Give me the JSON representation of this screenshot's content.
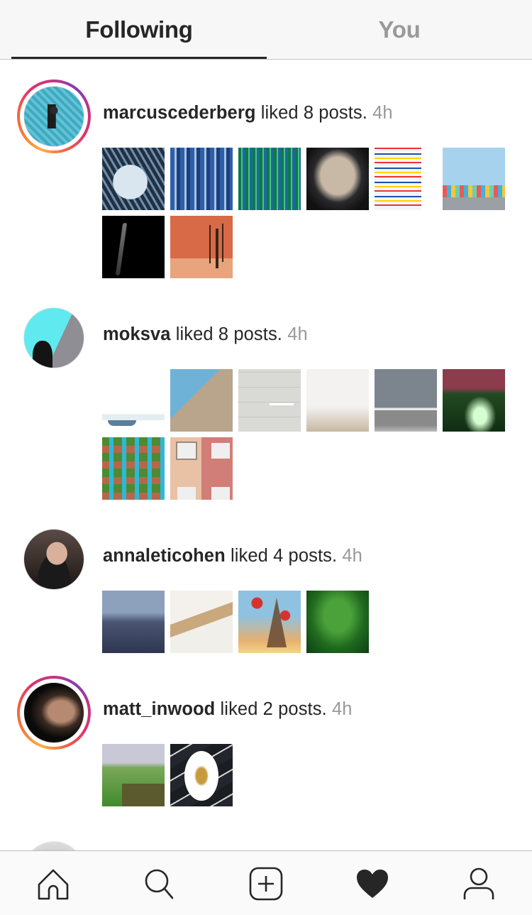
{
  "tabs": [
    {
      "label": "Following",
      "active": true
    },
    {
      "label": "You",
      "active": false
    }
  ],
  "feed": [
    {
      "username": "marcuscederberg",
      "action": " liked 8 posts. ",
      "time": "4h",
      "has_story_ring": true,
      "posts": [
        "curved-building-looking-up",
        "blue-glass-facade",
        "green-glass-building",
        "gallery-light-wall",
        "colorful-windows-facade",
        "beach-huts"
      ],
      "posts_row2": [
        "silhouette-figure",
        "dead-tree-desert"
      ]
    },
    {
      "username": "moksva",
      "action": " liked 8 posts. ",
      "time": "4h",
      "has_story_ring": false,
      "posts": [
        "boat-on-white",
        "couple-on-rocks",
        "figure-on-concrete-ledge",
        "foggy-figure",
        "birds-over-sea",
        "night-forest"
      ],
      "posts_row2": [
        "ivy-covered-building",
        "pink-facade-windows"
      ]
    },
    {
      "username": "annaleticohen",
      "action": " liked 4 posts. ",
      "time": "4h",
      "has_story_ring": false,
      "posts": [
        "handstand-dusk",
        "tea-products",
        "eiffel-tower-roses",
        "green-waterfall"
      ],
      "posts_row2": []
    },
    {
      "username": "matt_inwood",
      "action": " liked 2 posts. ",
      "time": "4h",
      "has_story_ring": true,
      "posts": [
        "cricket-field",
        "plated-dish-marble"
      ],
      "posts_row2": []
    }
  ],
  "bottom_nav": [
    {
      "name": "home",
      "icon": "home-icon"
    },
    {
      "name": "search",
      "icon": "search-icon"
    },
    {
      "name": "new-post",
      "icon": "plus-square-icon"
    },
    {
      "name": "activity",
      "icon": "heart-icon",
      "active": true
    },
    {
      "name": "profile",
      "icon": "user-icon"
    }
  ],
  "colors": {
    "text": "#262626",
    "muted": "#999999",
    "inactive_tab": "#9a9a9a",
    "ring_start": "#fcaf45",
    "ring_end": "#c13584"
  }
}
